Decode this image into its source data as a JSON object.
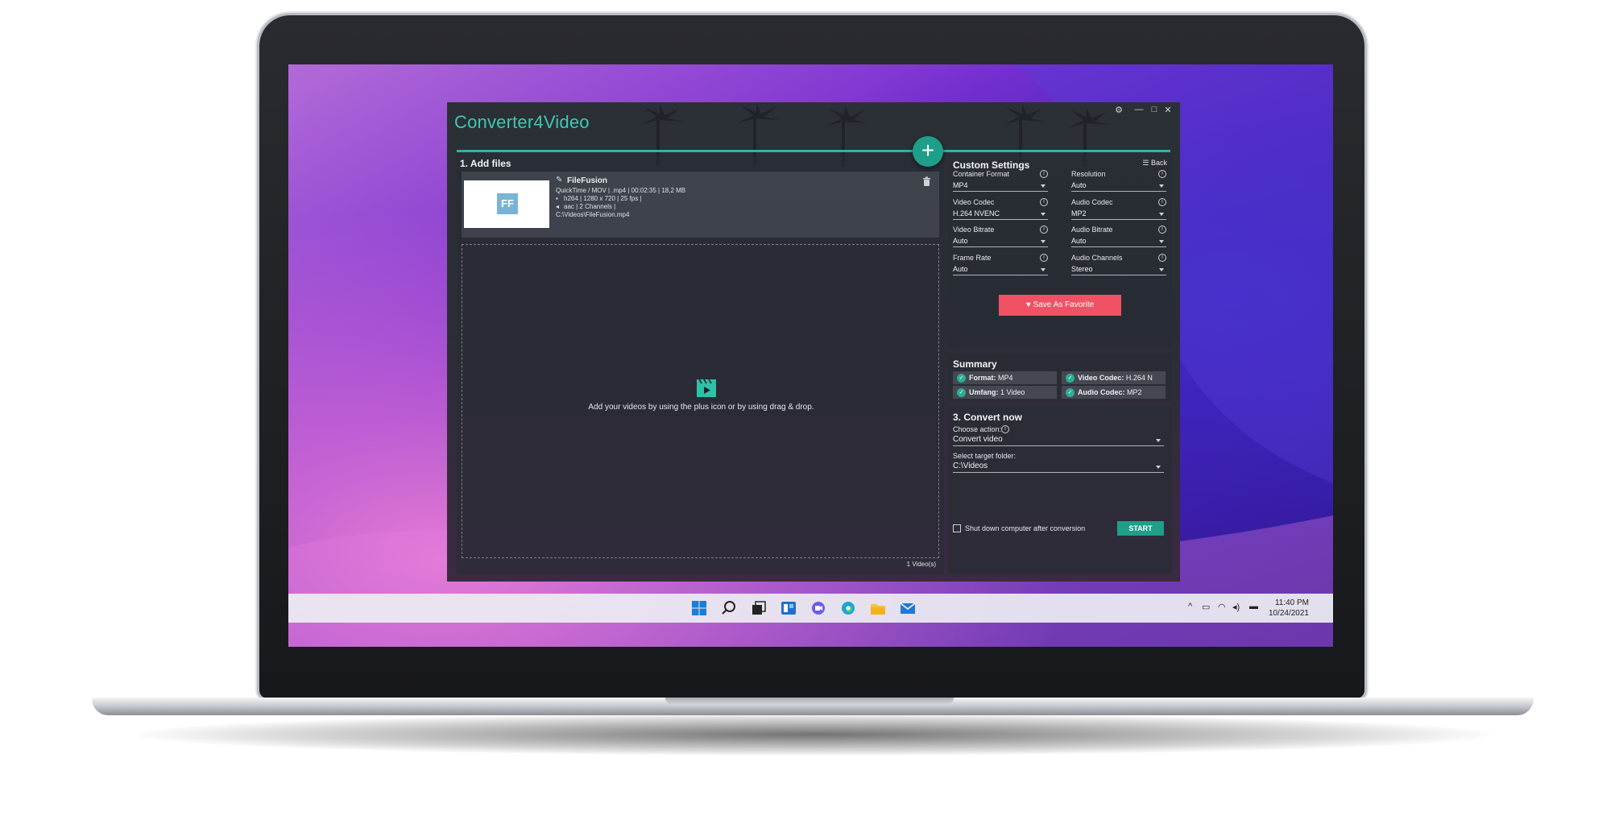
{
  "app": {
    "title": "Converter4Video",
    "window_controls": {
      "settings": "⚙",
      "minimize": "—",
      "maximize": "□",
      "close": "✕"
    }
  },
  "add_files": {
    "title": "1. Add files",
    "file": {
      "thumbnail_text": "FF",
      "name": "FileFusion",
      "container_line": "QuickTime / MOV | .mp4 | 00:02:35 | 18,2 MB",
      "video_line": "h264 | 1280 x 720 | 25 fps |",
      "audio_line": "aac | 2 Channels |",
      "path": "C:\\Videos\\FileFusion.mp4"
    },
    "drop_hint": "Add your videos by using the plus icon or by using drag & drop.",
    "count": "1 Video(s)"
  },
  "custom_settings": {
    "title": "Custom Settings",
    "back_label": "Back",
    "fields": [
      {
        "label": "Container Format",
        "value": "MP4"
      },
      {
        "label": "Resolution",
        "value": "Auto"
      },
      {
        "label": "Video Codec",
        "value": "H.264 NVENC"
      },
      {
        "label": "Audio Codec",
        "value": "MP2"
      },
      {
        "label": "Video Bitrate",
        "value": "Auto"
      },
      {
        "label": "Audio Bitrate",
        "value": "Auto"
      },
      {
        "label": "Frame Rate",
        "value": "Auto"
      },
      {
        "label": "Audio Channels",
        "value": "Stereo"
      }
    ],
    "favorite_label": "Save As Favorite"
  },
  "summary": {
    "title": "Summary",
    "items": [
      {
        "key": "Format:",
        "value": "MP4"
      },
      {
        "key": "Video Codec:",
        "value": "H.264 N"
      },
      {
        "key": "Umfang:",
        "value": "1 Video"
      },
      {
        "key": "Audio Codec:",
        "value": "MP2"
      }
    ]
  },
  "convert": {
    "title": "3. Convert now",
    "action_label": "Choose action:",
    "action_value": "Convert video",
    "folder_label": "Select target folder:",
    "folder_value": "C:\\Videos",
    "shutdown_label": "Shut down computer after conversion",
    "start_label": "START"
  },
  "taskbar": {
    "icons": [
      "windows-start-icon",
      "search-icon",
      "task-view-icon",
      "widgets-icon",
      "chat-icon",
      "edge-browser-icon",
      "file-explorer-icon",
      "mail-icon"
    ],
    "time": "11:40 PM",
    "date": "10/24/2021"
  },
  "colors": {
    "accent": "#1f9e8a",
    "favorite": "#f05164",
    "title": "#3dc9b4"
  }
}
